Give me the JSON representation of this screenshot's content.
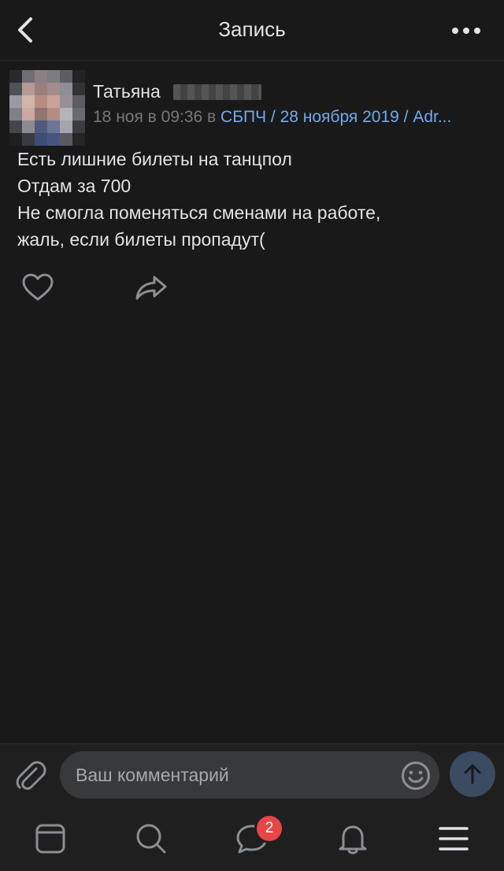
{
  "header": {
    "title": "Запись",
    "back_icon": "chevron-left-icon",
    "more_icon": "more-horizontal-icon"
  },
  "post": {
    "author": "Татьяна",
    "date": "18 ноя в 09:36 в ",
    "context_link": "СБПЧ / 28 ноября 2019 / Adr...",
    "text_lines": [
      "Есть лишние билеты на танцпол",
      "Отдам за 700",
      "Не смогла поменяться сменами на работе,",
      "жаль, если билеты пропадут("
    ],
    "actions": {
      "like_icon": "heart-icon",
      "share_icon": "share-icon"
    }
  },
  "composer": {
    "placeholder": "Ваш комментарий",
    "attach_icon": "paperclip-icon",
    "emoji_icon": "smile-icon",
    "send_icon": "arrow-up-icon"
  },
  "tabbar": {
    "messages_badge": "2",
    "icons": [
      "feed-icon",
      "search-icon",
      "messages-icon",
      "bell-icon",
      "menu-icon"
    ]
  },
  "colors": {
    "background": "#19191a",
    "text": "#e1e3e6",
    "secondary_text": "#76787a",
    "link": "#71aaeb",
    "badge": "#e64646",
    "send_button": "#3a4b62"
  }
}
